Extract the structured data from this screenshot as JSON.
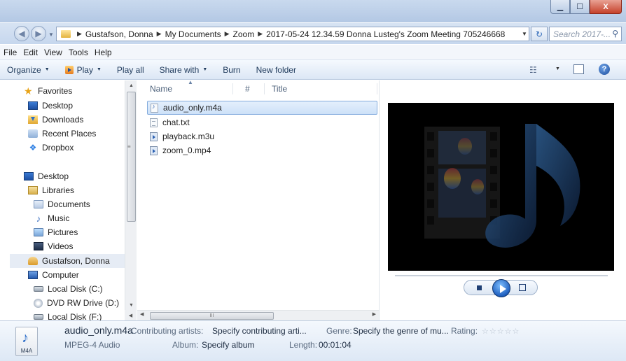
{
  "window": {
    "minimize_glyph": "▁",
    "maximize_glyph": "☐",
    "close_glyph": "X"
  },
  "address": {
    "crumbs": [
      "Gustafson, Donna",
      "My Documents",
      "Zoom",
      "2017-05-24 12.34.59 Donna Lusteg's Zoom Meeting 705246668"
    ],
    "search_placeholder": "Search 2017-..."
  },
  "menu": [
    "File",
    "Edit",
    "View",
    "Tools",
    "Help"
  ],
  "toolbar": {
    "organize": "Organize",
    "play": "Play",
    "play_all": "Play all",
    "share_with": "Share with",
    "burn": "Burn",
    "new_folder": "New folder"
  },
  "nav": {
    "favorites": "Favorites",
    "desktop_fav": "Desktop",
    "downloads": "Downloads",
    "recent_places": "Recent Places",
    "dropbox": "Dropbox",
    "desktop": "Desktop",
    "libraries": "Libraries",
    "documents": "Documents",
    "music": "Music",
    "pictures": "Pictures",
    "videos": "Videos",
    "user": "Gustafson, Donna",
    "computer": "Computer",
    "local_c": "Local Disk (C:)",
    "dvd": "DVD RW Drive (D:)",
    "local_f": "Local Disk (F:)"
  },
  "columns": {
    "name": "Name",
    "number": "#",
    "title": "Title"
  },
  "files": [
    {
      "name": "audio_only.m4a",
      "type": "audio",
      "selected": true
    },
    {
      "name": "chat.txt",
      "type": "text",
      "selected": false
    },
    {
      "name": "playback.m3u",
      "type": "media",
      "selected": false
    },
    {
      "name": "zoom_0.mp4",
      "type": "media",
      "selected": false
    }
  ],
  "hscroll_grip": "III",
  "details": {
    "icon_label": "M4A",
    "file_name": "audio_only.m4a",
    "file_type": "MPEG-4 Audio",
    "artists_label": "Contributing artists:",
    "artists_value": "Specify contributing arti...",
    "genre_label": "Genre:",
    "genre_value": "Specify the genre of mu...",
    "rating_label": "Rating:",
    "rating_stars": "☆☆☆☆☆",
    "album_label": "Album:",
    "album_value": "Specify album",
    "length_label": "Length:",
    "length_value": "00:01:04"
  }
}
